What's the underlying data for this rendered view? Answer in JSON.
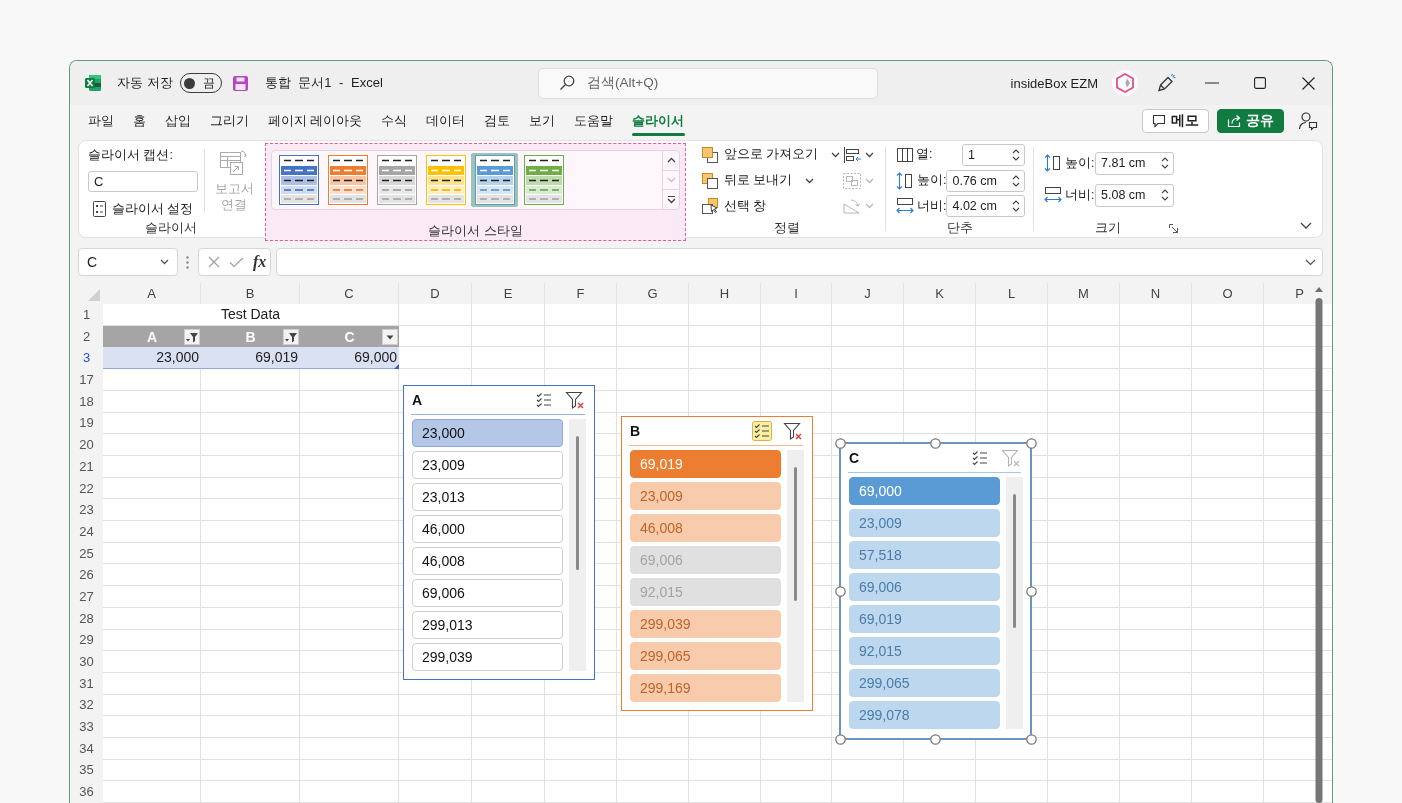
{
  "title_bar": {
    "autosave": {
      "label": "자동 저장",
      "on": false,
      "state_label": "끔"
    },
    "document_title": "통합 문서1 - Excel",
    "search": {
      "placeholder": "검색(Alt+Q)"
    },
    "account_name": "insideBox EZM"
  },
  "ribbon_tabs": [
    {
      "label": "파일",
      "selected": false
    },
    {
      "label": "홈",
      "selected": false
    },
    {
      "label": "삽입",
      "selected": false
    },
    {
      "label": "그리기",
      "selected": false
    },
    {
      "label": "페이지 레이아웃",
      "selected": false
    },
    {
      "label": "수식",
      "selected": false
    },
    {
      "label": "데이터",
      "selected": false
    },
    {
      "label": "검토",
      "selected": false
    },
    {
      "label": "보기",
      "selected": false
    },
    {
      "label": "도움말",
      "selected": false
    },
    {
      "label": "슬라이서",
      "selected": true
    }
  ],
  "tab_bar_buttons": [
    {
      "kind": "comments",
      "label": "메모"
    },
    {
      "kind": "share",
      "label": "공유"
    }
  ],
  "ribbon": {
    "slicer_group": {
      "title": "슬라이서",
      "caption_label": "슬라이서 캡션:",
      "caption_value": "C",
      "settings_button": "슬라이서 설정",
      "report_connections": {
        "label": "보고서 연결",
        "disabled": true
      }
    },
    "styles_group": {
      "title": "슬라이서 스타일",
      "highlighted": true,
      "styles": [
        {
          "color": "#4472c4",
          "selected": false
        },
        {
          "color": "#ed7d31",
          "selected": false
        },
        {
          "color": "#a5a5a5",
          "selected": false
        },
        {
          "color": "#ffc000",
          "selected": false
        },
        {
          "color": "#5b9bd5",
          "selected": true
        },
        {
          "color": "#70ad47",
          "selected": false
        }
      ],
      "gallery_scroll": [
        {
          "kind": "up",
          "disabled": false
        },
        {
          "kind": "down",
          "disabled": true
        },
        {
          "kind": "more",
          "disabled": false
        }
      ]
    },
    "arrange_group": {
      "title": "정렬",
      "commands": [
        {
          "label": "앞으로 가져오기",
          "has_menu": true
        },
        {
          "label": "뒤로 보내기",
          "has_menu": true
        },
        {
          "label": "선택 창",
          "has_menu": false
        }
      ],
      "tools": [
        {
          "disabled": false
        },
        {
          "disabled": true
        },
        {
          "disabled": true
        }
      ]
    },
    "buttons_group": {
      "title": "단추",
      "fields": [
        {
          "kind": "columns",
          "label": "열:",
          "value": "1"
        },
        {
          "kind": "height",
          "label": "높이:",
          "value": "0.76 cm"
        },
        {
          "kind": "width",
          "label": "너비:",
          "value": "4.02 cm"
        }
      ]
    },
    "size_group": {
      "title": "크기",
      "fields": [
        {
          "kind": "height",
          "label": "높이:",
          "value": "7.81 cm"
        },
        {
          "kind": "width",
          "label": "너비:",
          "value": "5.08 cm"
        }
      ]
    }
  },
  "formula_bar": {
    "name_box": "C",
    "function_label": "fx"
  },
  "sheet": {
    "columns": [
      "A",
      "B",
      "C",
      "D",
      "E",
      "F",
      "G",
      "H",
      "I",
      "J",
      "K",
      "L",
      "M",
      "N",
      "O",
      "P"
    ],
    "rows": [
      {
        "label": "1",
        "filtered": false
      },
      {
        "label": "2",
        "filtered": false
      },
      {
        "label": "3",
        "filtered": true
      },
      {
        "label": "17",
        "filtered": false
      },
      {
        "label": "18",
        "filtered": false
      },
      {
        "label": "19",
        "filtered": false
      },
      {
        "label": "20",
        "filtered": false
      },
      {
        "label": "21",
        "filtered": false
      },
      {
        "label": "22",
        "filtered": false
      },
      {
        "label": "23",
        "filtered": false
      },
      {
        "label": "24",
        "filtered": false
      },
      {
        "label": "25",
        "filtered": false
      },
      {
        "label": "26",
        "filtered": false
      },
      {
        "label": "27",
        "filtered": false
      },
      {
        "label": "28",
        "filtered": false
      },
      {
        "label": "29",
        "filtered": false
      },
      {
        "label": "30",
        "filtered": false
      },
      {
        "label": "31",
        "filtered": false
      },
      {
        "label": "32",
        "filtered": false
      },
      {
        "label": "33",
        "filtered": false
      },
      {
        "label": "34",
        "filtered": false
      },
      {
        "label": "35",
        "filtered": false
      },
      {
        "label": "36",
        "filtered": false
      }
    ],
    "table": {
      "title": "Test Data",
      "headers": [
        {
          "label": "A",
          "filtered": true
        },
        {
          "label": "B",
          "filtered": true
        },
        {
          "label": "C",
          "filtered": false
        }
      ],
      "values": [
        "23,000",
        "69,019",
        "69,000"
      ]
    }
  },
  "slicers": [
    {
      "caption": "A",
      "kind": "light",
      "color": "#4472c4",
      "multi_select": false,
      "clear_filter_enabled": true,
      "shape_selected": false,
      "items": [
        {
          "label": "23,000",
          "selected": true,
          "has_data": true
        },
        {
          "label": "23,009",
          "selected": false,
          "has_data": true
        },
        {
          "label": "23,013",
          "selected": false,
          "has_data": true
        },
        {
          "label": "46,000",
          "selected": false,
          "has_data": true
        },
        {
          "label": "46,008",
          "selected": false,
          "has_data": true
        },
        {
          "label": "69,006",
          "selected": false,
          "has_data": true
        },
        {
          "label": "299,013",
          "selected": false,
          "has_data": true
        },
        {
          "label": "299,039",
          "selected": false,
          "has_data": true
        }
      ]
    },
    {
      "caption": "B",
      "kind": "dark",
      "color": "#ed7d31",
      "multi_select": true,
      "clear_filter_enabled": true,
      "shape_selected": false,
      "items": [
        {
          "label": "69,019",
          "selected": true,
          "has_data": true
        },
        {
          "label": "23,009",
          "selected": false,
          "has_data": true
        },
        {
          "label": "46,008",
          "selected": false,
          "has_data": true
        },
        {
          "label": "69,006",
          "selected": false,
          "has_data": false
        },
        {
          "label": "92,015",
          "selected": false,
          "has_data": false
        },
        {
          "label": "299,039",
          "selected": false,
          "has_data": true
        },
        {
          "label": "299,065",
          "selected": false,
          "has_data": true
        },
        {
          "label": "299,169",
          "selected": false,
          "has_data": true
        }
      ]
    },
    {
      "caption": "C",
      "kind": "dark",
      "color": "#5b9bd5",
      "multi_select": false,
      "clear_filter_enabled": false,
      "shape_selected": true,
      "items": [
        {
          "label": "69,000",
          "selected": true,
          "has_data": true
        },
        {
          "label": "23,009",
          "selected": false,
          "has_data": true
        },
        {
          "label": "57,518",
          "selected": false,
          "has_data": true
        },
        {
          "label": "69,006",
          "selected": false,
          "has_data": true
        },
        {
          "label": "69,019",
          "selected": false,
          "has_data": true
        },
        {
          "label": "92,015",
          "selected": false,
          "has_data": true
        },
        {
          "label": "299,065",
          "selected": false,
          "has_data": true
        },
        {
          "label": "299,078",
          "selected": false,
          "has_data": true
        }
      ]
    }
  ]
}
